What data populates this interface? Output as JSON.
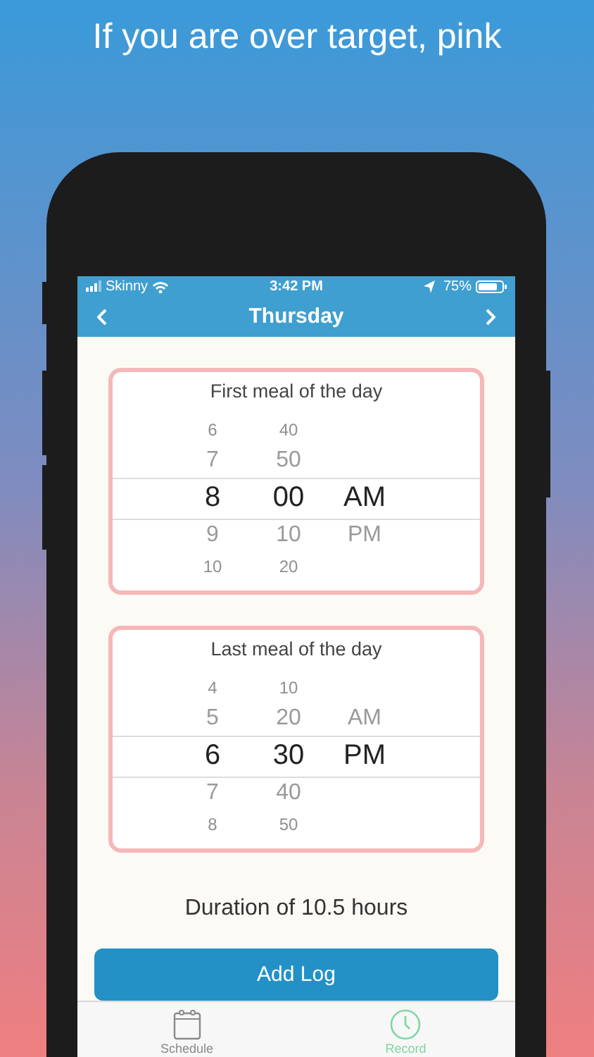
{
  "headline": "If you are over target, pink",
  "status_bar": {
    "carrier": "Skinny",
    "time": "3:42 PM",
    "battery": "75%"
  },
  "nav": {
    "title": "Thursday"
  },
  "pickers": [
    {
      "label": "First meal of the day",
      "columns": [
        {
          "items": [
            {
              "text": "6",
              "selected": false
            },
            {
              "text": "7",
              "selected": false
            },
            {
              "text": "8",
              "selected": true
            },
            {
              "text": "9",
              "selected": false
            },
            {
              "text": "10",
              "selected": false
            }
          ]
        },
        {
          "items": [
            {
              "text": "40",
              "selected": false
            },
            {
              "text": "50",
              "selected": false
            },
            {
              "text": "00",
              "selected": true
            },
            {
              "text": "10",
              "selected": false
            },
            {
              "text": "20",
              "selected": false
            }
          ]
        },
        {
          "items": [
            {
              "text": "AM",
              "selected": true
            },
            {
              "text": "PM",
              "selected": false
            }
          ]
        }
      ]
    },
    {
      "label": "Last meal of the day",
      "columns": [
        {
          "items": [
            {
              "text": "4",
              "selected": false
            },
            {
              "text": "5",
              "selected": false
            },
            {
              "text": "6",
              "selected": true
            },
            {
              "text": "7",
              "selected": false
            },
            {
              "text": "8",
              "selected": false
            }
          ]
        },
        {
          "items": [
            {
              "text": "10",
              "selected": false
            },
            {
              "text": "20",
              "selected": false
            },
            {
              "text": "30",
              "selected": true
            },
            {
              "text": "40",
              "selected": false
            },
            {
              "text": "50",
              "selected": false
            }
          ]
        },
        {
          "items": [
            {
              "text": "AM",
              "selected": false
            },
            {
              "text": "PM",
              "selected": true
            }
          ]
        }
      ]
    }
  ],
  "duration": "Duration of 10.5 hours",
  "button": "Add Log",
  "tabs": [
    {
      "label": "Schedule",
      "selected": false
    },
    {
      "label": "Record",
      "selected": true
    }
  ]
}
